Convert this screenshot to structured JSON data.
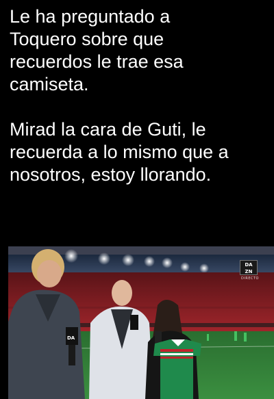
{
  "tweet": {
    "paragraph_1": "Le ha preguntado a\nToquero sobre que\nrecuerdos le trae esa\ncamiseta.",
    "paragraph_2": "Mirad la cara de Guti, le\nrecuerda a lo mismo que a\nnosotros, estoy llorando."
  },
  "media": {
    "broadcaster_logo": "DA\nZN",
    "live_label": "DIRECTO",
    "colors": {
      "stands_red": "#8a1c22",
      "pitch_green": "#2f7a35",
      "jersey_green": "#1f8a4c",
      "jersey_stripe_red": "#c0222c"
    }
  }
}
